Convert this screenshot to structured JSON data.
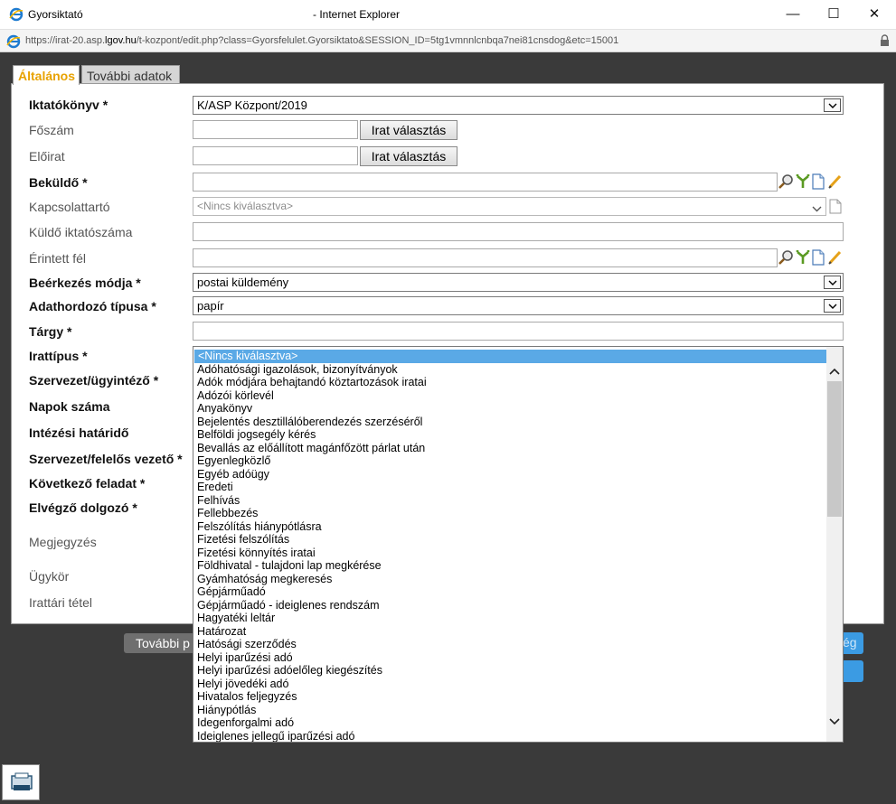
{
  "window": {
    "app_title": "Gyorsiktató",
    "browser_title": "- Internet Explorer",
    "minimize": "—",
    "maximize": "☐",
    "close": "✕"
  },
  "address": {
    "url_prefix": "https://irat-20.asp.",
    "url_domain": "lgov.hu",
    "url_rest": "/t-kozpont/edit.php?class=Gyorsfelulet.Gyorsiktato&SESSION_ID=5tg1vmnnlcnbqa7nei81cnsdog&etc=15001"
  },
  "tabs": [
    {
      "label": "Általános",
      "active": true
    },
    {
      "label": "További adatok",
      "active": false
    }
  ],
  "form": {
    "iktatokonyv": {
      "label": "Iktatókönyv *",
      "value": "K/ASP Központ/2019"
    },
    "foszam": {
      "label": "Főszám",
      "button": "Irat választás"
    },
    "eloirat": {
      "label": "Előirat",
      "button": "Irat választás"
    },
    "bekuldo": {
      "label": "Beküldő *"
    },
    "kapcsolattarto": {
      "label": "Kapcsolattartó",
      "value": "<Nincs kiválasztva>"
    },
    "kuldo_iktatoszama": {
      "label": "Küldő iktatószáma"
    },
    "erintett_fel": {
      "label": "Érintett fél"
    },
    "beerkezes_modja": {
      "label": "Beérkezés módja *",
      "value": "postai küldemény"
    },
    "adathordozo": {
      "label": "Adathordozó típusa *",
      "value": "papír"
    },
    "targy": {
      "label": "Tárgy *"
    },
    "irattipus": {
      "label": "Irattípus *"
    },
    "szervezet_ugyintezo": {
      "label": "Szervezet/ügyintéző *"
    },
    "napok_szama": {
      "label": "Napok száma"
    },
    "intezesi_hatarido": {
      "label": "Intézési határidő"
    },
    "szervezet_felelos": {
      "label": "Szervezet/felelős vezető *"
    },
    "kovetkezo_feladat": {
      "label": "Következő feladat *"
    },
    "elvegzo_dolgozo": {
      "label": "Elvégző dolgozó *"
    },
    "megjegyzes": {
      "label": "Megjegyzés"
    },
    "ugykor": {
      "label": "Ügykör"
    },
    "irattari_tetel": {
      "label": "Irattári tétel"
    }
  },
  "dropdown": {
    "items": [
      "<Nincs kiválasztva>",
      "Adóhatósági igazolások, bizonyítványok",
      "Adók módjára behajtandó köztartozások iratai",
      "Adózói körlevél",
      "Anyakönyv",
      "Bejelentés desztillálóberendezés szerzéséről",
      "Belföldi jogsegély kérés",
      "Bevallás az előállított magánfőzött párlat után",
      "Egyenlegközlő",
      "Egyéb adóügy",
      "Eredeti",
      "Felhívás",
      "Fellebbezés",
      "Felszólítás hiánypótlásra",
      "Fizetési felszólítás",
      "Fizetési könnyítés iratai",
      "Földhivatal - tulajdoni lap megkérése",
      "Gyámhatóság megkeresés",
      "Gépjárműadó",
      "Gépjárműadó - ideiglenes rendszám",
      "Hagyatéki leltár",
      "Határozat",
      "Hatósági szerződés",
      "Helyi iparűzési adó",
      "Helyi iparűzési adóelőleg kiegészítés",
      "Helyi jövedéki adó",
      "Hivatalos feljegyzés",
      "Hiánypótlás",
      "Idegenforgalmi adó",
      "Ideiglenes jellegű iparűzési adó"
    ]
  },
  "bottom": {
    "tovabbi_label": "További p",
    "right_label": "ég"
  }
}
